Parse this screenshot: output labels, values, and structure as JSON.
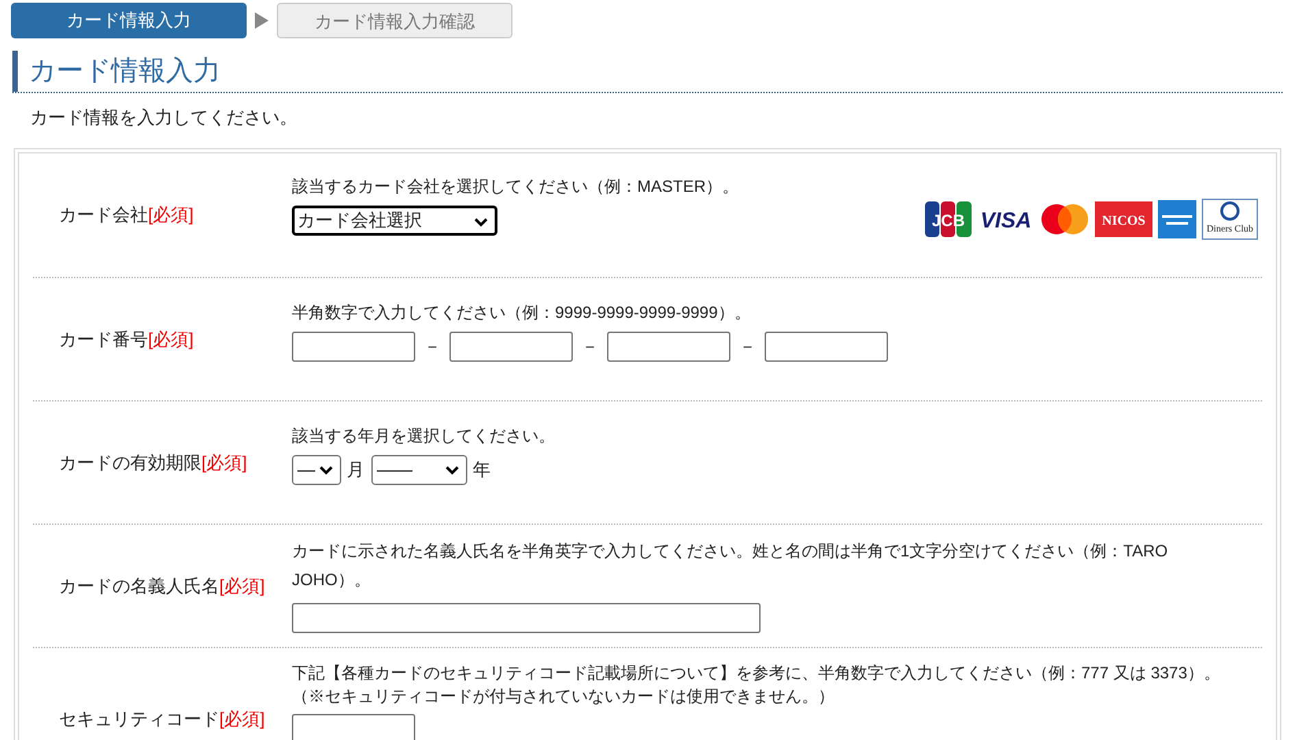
{
  "steps": [
    {
      "label": "カード情報入力",
      "selected": true
    },
    {
      "label": "カード情報入力確認",
      "selected": false
    }
  ],
  "heading": "カード情報入力",
  "intro": "カード情報を入力してください。",
  "rows": [
    {
      "kind": "select",
      "label": "カード会社",
      "required": "[必須]",
      "notes": [
        "該当するカード会社を選択してください（例：MASTER）。"
      ],
      "value": "カード会社選択",
      "brands": [
        {
          "kind": "jcb",
          "label": "JCB"
        },
        {
          "kind": "visa",
          "label": "VISA"
        },
        {
          "kind": "mastercard"
        },
        {
          "kind": "nicos",
          "label": "NICOS"
        },
        {
          "kind": "amex"
        },
        {
          "kind": "diners",
          "label": "Diners Club"
        }
      ]
    },
    {
      "kind": "card_number",
      "label": "カード番号",
      "required": "[必須]",
      "notes": [
        "半角数字で入力してください（例：9999-9999-9999-9999）。"
      ],
      "separator": "－"
    },
    {
      "kind": "expiry",
      "label": "カードの有効期限",
      "required": "[必須]",
      "notes": [
        "該当する年月を選択してください。"
      ],
      "month": "—",
      "month_unit": "月",
      "year": "——",
      "year_unit": "年"
    },
    {
      "kind": "text",
      "label": "カードの名義人氏名",
      "required": "[必須]",
      "notes": [
        "カードに示された名義人氏名を半角英字で入力してください。姓と名の間は半角で1文字分空けてください（例：TARO JOHO）。"
      ]
    },
    {
      "kind": "security",
      "label": "セキュリティコード",
      "required": "[必須]",
      "notes": [
        "下記【各種カードのセキュリティコード記載場所について】を参考に、半角数字で入力してください（例：777 又は 3373）。",
        "（※セキュリティコードが付与されていないカードは使用できません。）"
      ]
    }
  ]
}
